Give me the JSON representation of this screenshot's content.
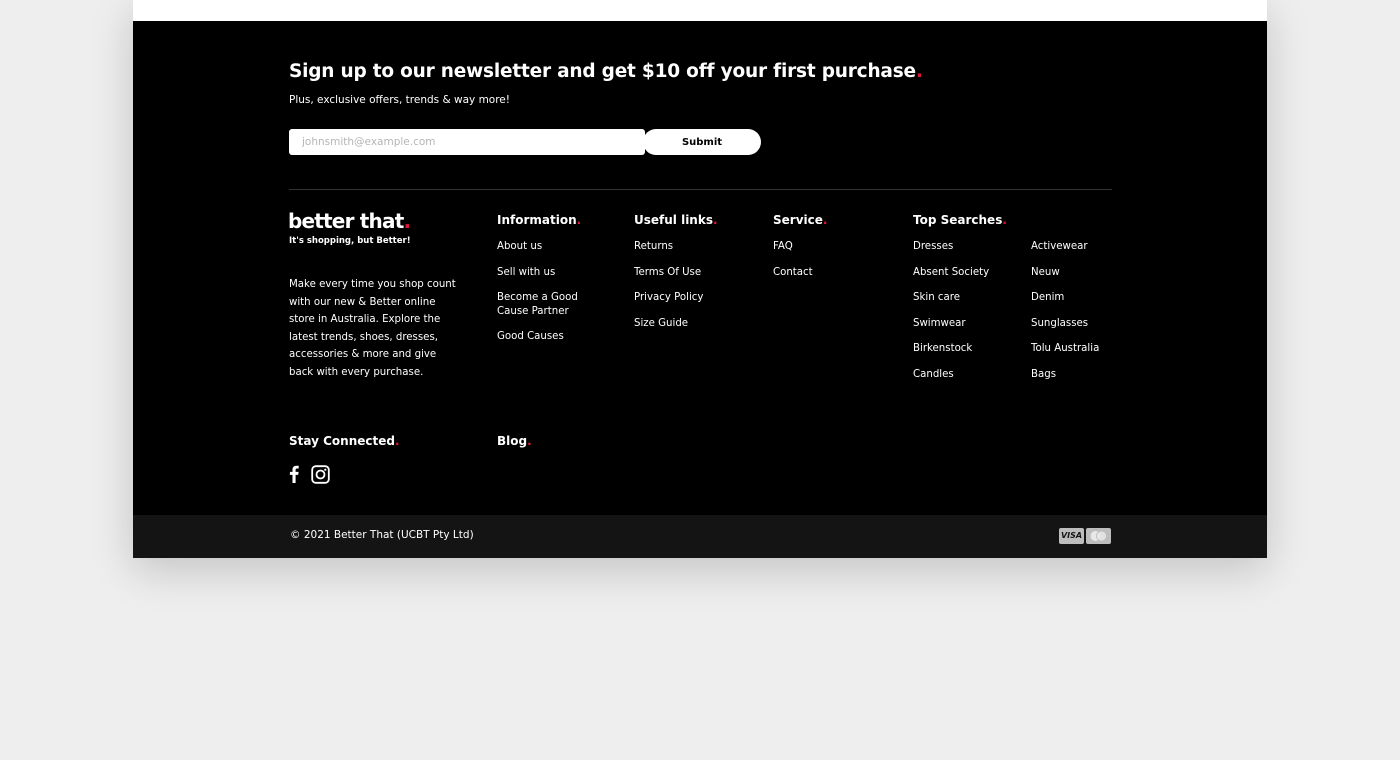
{
  "newsletter": {
    "heading": "Sign up to our newsletter and get $10 off your first purchase",
    "subtext": "Plus, exclusive offers, trends & way more!",
    "email_placeholder": "johnsmith@example.com",
    "submit_label": "Submit"
  },
  "brand": {
    "logo_text": "better that",
    "tagline": "It's shopping, but Better!",
    "description": "Make every time you shop count with our new & Better online store in Australia. Explore the latest trends, shoes, dresses, accessories & more and give back with every purchase."
  },
  "information": {
    "heading": "Information",
    "links": [
      "About us",
      "Sell with us",
      "Become a Good Cause Partner",
      "Good Causes"
    ]
  },
  "useful_links": {
    "heading": "Useful links",
    "links": [
      "Returns",
      "Terms Of Use",
      "Privacy Policy",
      "Size Guide"
    ]
  },
  "service": {
    "heading": "Service",
    "links": [
      "FAQ",
      "Contact"
    ]
  },
  "top_searches": {
    "heading": "Top Searches",
    "col1": [
      "Dresses",
      "Absent Society",
      "Skin care",
      "Swimwear",
      "Birkenstock",
      "Candles"
    ],
    "col2": [
      "Activewear",
      "Neuw",
      "Denim",
      "Sunglasses",
      "Tolu Australia",
      "Bags"
    ]
  },
  "stay_connected": {
    "heading": "Stay Connected",
    "icons": [
      "facebook-icon",
      "instagram-icon"
    ]
  },
  "blog": {
    "heading": "Blog"
  },
  "bottom_bar": {
    "copyright": "© 2021 Better That (UCBT Pty Ltd)",
    "payment_icons": [
      "visa-icon",
      "mastercard-icon"
    ],
    "visa_text": "VISA"
  },
  "colors": {
    "accent": "#e0153a",
    "footer_bg": "#000000",
    "bottom_bar_bg": "#141414",
    "page_bg": "#eeeeee"
  }
}
